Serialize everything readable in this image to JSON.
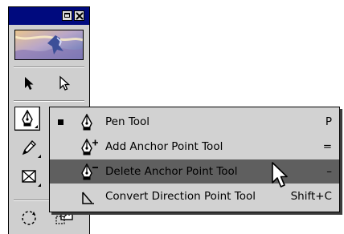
{
  "palette": {
    "tools": [
      {
        "name": "selection-tool",
        "icon": "black-arrow-icon"
      },
      {
        "name": "direct-selection-tool",
        "icon": "white-arrow-icon"
      },
      {
        "name": "pen-tool",
        "icon": "pen-icon",
        "active": true
      },
      {
        "name": "pencil-tool",
        "icon": "pencil-icon"
      },
      {
        "name": "rectangle-frame-tool",
        "icon": "frame-x-icon"
      },
      {
        "name": "rotate-tool",
        "icon": "rotate-icon"
      },
      {
        "name": "scale-tool",
        "icon": "scale-icon"
      }
    ]
  },
  "flyout": {
    "items": [
      {
        "label": "Pen Tool",
        "shortcut": "P",
        "checked": true,
        "icon": "pen-icon"
      },
      {
        "label": "Add Anchor Point Tool",
        "shortcut": "=",
        "checked": false,
        "icon": "add-anchor-pen-icon"
      },
      {
        "label": "Delete Anchor Point Tool",
        "shortcut": "–",
        "checked": false,
        "highlighted": true,
        "icon": "delete-anchor-pen-icon"
      },
      {
        "label": "Convert Direction Point Tool",
        "shortcut": "Shift+C",
        "checked": false,
        "icon": "convert-point-icon"
      }
    ]
  },
  "colors": {
    "titlebar": "#000a7e",
    "menu_bg": "#d2d2d2",
    "menu_highlight": "#5f5f5f",
    "palette_bg": "#cfcfcf"
  }
}
